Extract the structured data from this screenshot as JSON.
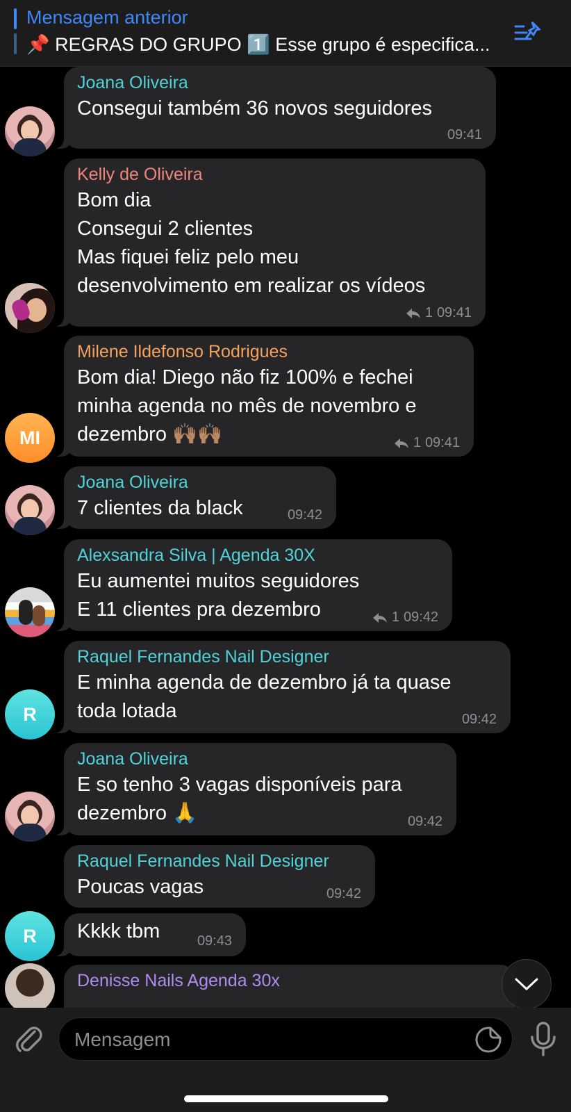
{
  "pinned": {
    "title": "Mensagem anterior",
    "text": "📌 REGRAS DO GRUPO 1️⃣ Esse grupo é especifica..."
  },
  "messages": [
    {
      "sender": "Joana Oliveira",
      "sender_color": "#4fd3d9",
      "text": "Consegui também 36 novos seguidores",
      "time": "09:41",
      "replies": ""
    },
    {
      "sender": "Kelly de Oliveira",
      "sender_color": "#f0857d",
      "text": "Bom dia\nConsegui 2 clientes\nMas fiquei feliz pelo meu\ndesenvolvimento em realizar os vídeos",
      "time": "09:41",
      "replies": "1"
    },
    {
      "sender": "Milene Ildefonso Rodrigues",
      "sender_color": "#f5a25d",
      "text": "Bom dia! Diego não fiz 100% e fechei\nminha agenda no mês de novembro e\ndezembro 🙌🏽🙌🏽",
      "time": "09:41",
      "replies": "1",
      "avatar_initials": "MI"
    },
    {
      "sender": "Joana Oliveira",
      "sender_color": "#4fd3d9",
      "text": "7 clientes da black",
      "time": "09:42",
      "replies": ""
    },
    {
      "sender": "Alexsandra Silva | Agenda 30X",
      "sender_color": "#4fd3d9",
      "text": "Eu aumentei muitos seguidores\nE 11 clientes pra dezembro",
      "time": "09:42",
      "replies": "1"
    },
    {
      "sender": "Raquel Fernandes Nail Designer",
      "sender_color": "#4fd3d9",
      "text": "E minha agenda de dezembro já ta quase\ntoda lotada",
      "time": "09:42",
      "replies": "",
      "avatar_initials": "R"
    },
    {
      "sender": "Joana Oliveira",
      "sender_color": "#4fd3d9",
      "text": "E so tenho 3 vagas disponíveis para\ndezembro 🙏",
      "time": "09:42",
      "replies": ""
    },
    {
      "sender": "Raquel Fernandes Nail Designer",
      "sender_color": "#4fd3d9",
      "text": "Poucas vagas",
      "time": "09:42",
      "replies": ""
    },
    {
      "sender": "",
      "text": "Kkkk tbm",
      "time": "09:43",
      "replies": "",
      "avatar_initials": "R"
    },
    {
      "sender": "Denisse Nails Agenda 30x",
      "sender_color": "#b08cf0",
      "text": "",
      "time": "",
      "replies": ""
    }
  ],
  "composer": {
    "placeholder": "Mensagem"
  },
  "icons": {
    "pinned_list": "pinned-list-icon",
    "reply": "reply-arrow-icon",
    "scroll_down": "chevron-down-icon",
    "attach": "paperclip-icon",
    "sticker": "sticker-icon",
    "mic": "microphone-icon"
  },
  "colors": {
    "accent": "#3e88f7",
    "bubble": "#262628",
    "background": "#000000",
    "meta": "#8e8e93"
  }
}
